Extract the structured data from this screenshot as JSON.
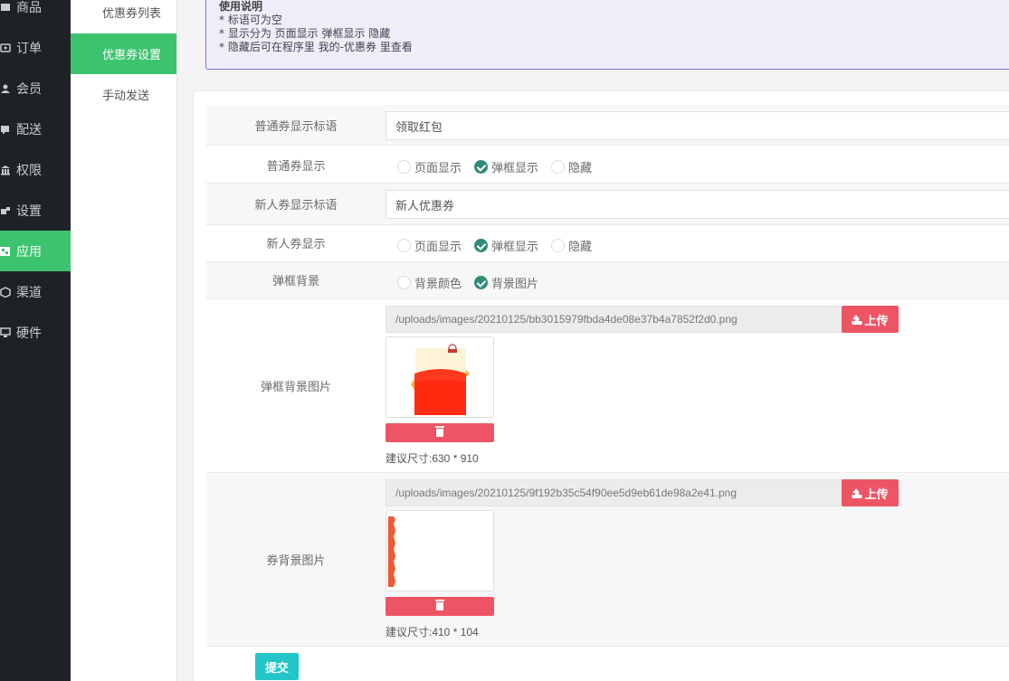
{
  "sidebar": {
    "items": [
      {
        "label": "商品",
        "icon": "product-icon"
      },
      {
        "label": "订单",
        "icon": "order-icon"
      },
      {
        "label": "会员",
        "icon": "member-icon"
      },
      {
        "label": "配送",
        "icon": "delivery-icon"
      },
      {
        "label": "权限",
        "icon": "permission-icon"
      },
      {
        "label": "设置",
        "icon": "settings-icon"
      },
      {
        "label": "应用",
        "icon": "apps-icon",
        "active": true
      },
      {
        "label": "渠道",
        "icon": "channel-icon"
      },
      {
        "label": "硬件",
        "icon": "hardware-icon"
      }
    ]
  },
  "submenu": {
    "items": [
      {
        "label": "优惠券列表"
      },
      {
        "label": "优惠券设置",
        "active": true
      },
      {
        "label": "手动发送"
      }
    ]
  },
  "notice": {
    "title": "使用说明",
    "lines": [
      "* 标语可为空",
      "* 显示分为 页面显示 弹框显示 隐藏",
      "* 隐藏后可在程序里 我的-优惠券 里查看"
    ]
  },
  "form": {
    "normal_slogan": {
      "label": "普通券显示标语",
      "value": "领取红包"
    },
    "normal_display": {
      "label": "普通券显示",
      "options": [
        "页面显示",
        "弹框显示",
        "隐藏"
      ],
      "selected": "弹框显示"
    },
    "newbie_slogan": {
      "label": "新人券显示标语",
      "value": "新人优惠券"
    },
    "newbie_display": {
      "label": "新人券显示",
      "options": [
        "页面显示",
        "弹框显示",
        "隐藏"
      ],
      "selected": "弹框显示"
    },
    "popup_bg": {
      "label": "弹框背景",
      "options": [
        "背景颜色",
        "背景图片"
      ],
      "selected": "背景图片"
    },
    "popup_bg_image": {
      "label": "弹框背景图片",
      "path": "/uploads/images/20210125/bb3015979fbda4de08e37b4a7852f2d0.png",
      "upload_label": "上传",
      "hint": "建议尺寸:630 * 910"
    },
    "coupon_bg_image": {
      "label": "券背景图片",
      "path": "/uploads/images/20210125/9f192b35c54f90ee5d9eb61de98a2e41.png",
      "upload_label": "上传",
      "hint": "建议尺寸:410 * 104"
    },
    "submit_label": "提交"
  },
  "colors": {
    "sidebar_bg": "#1e2227",
    "active_green": "#3cc36e",
    "danger_red": "#ed5565",
    "submit_teal": "#23c6c8",
    "radio_checked": "#2f8c76",
    "notice_border": "#8b6fd3"
  }
}
